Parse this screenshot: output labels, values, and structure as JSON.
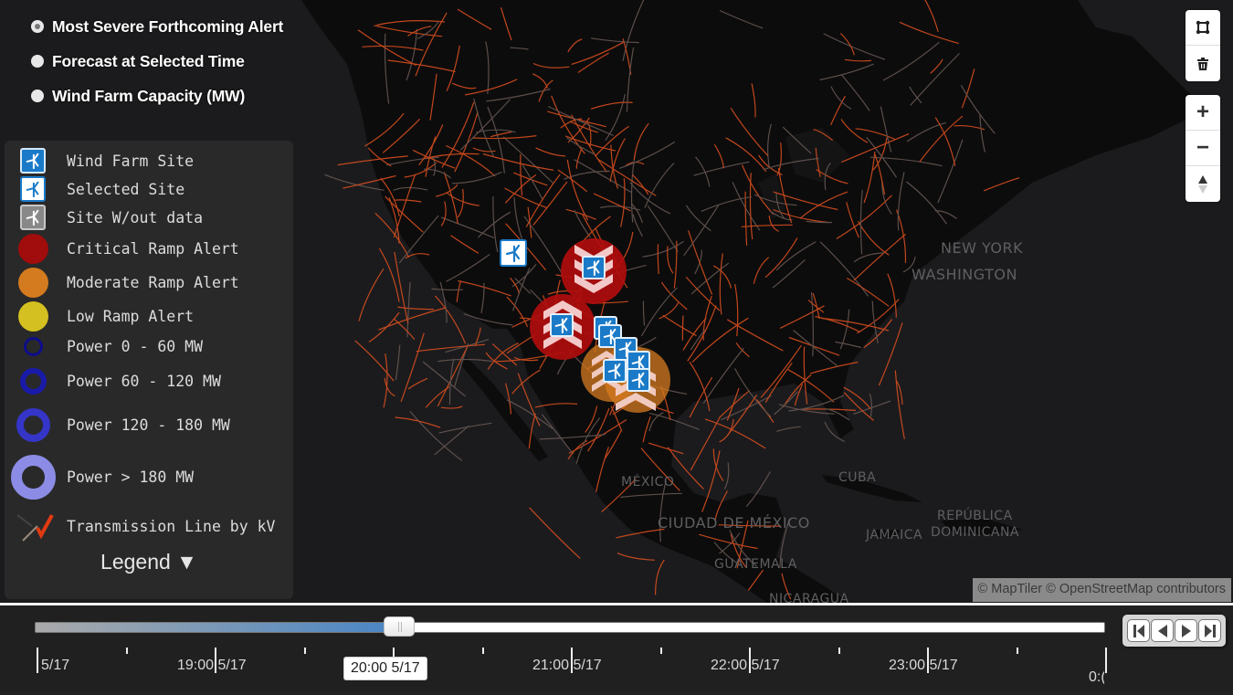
{
  "layer_selector": {
    "options": [
      {
        "label": "Most Severe Forthcoming Alert",
        "checked": true
      },
      {
        "label": "Forecast at Selected Time",
        "checked": false
      },
      {
        "label": "Wind Farm Capacity (MW)",
        "checked": false
      }
    ]
  },
  "legend": {
    "items": [
      {
        "symbol": "wind-farm-site-icon",
        "label": "Wind Farm Site"
      },
      {
        "symbol": "selected-site-icon",
        "label": "Selected Site"
      },
      {
        "symbol": "site-without-data-icon",
        "label": "Site W/out data"
      },
      {
        "symbol": "critical-alert-circle",
        "label": "Critical Ramp Alert",
        "color": "#a10c0c"
      },
      {
        "symbol": "moderate-alert-circle",
        "label": "Moderate Ramp Alert",
        "color": "#d47a1f"
      },
      {
        "symbol": "low-alert-circle",
        "label": "Low Ramp Alert",
        "color": "#d4c020"
      },
      {
        "symbol": "power-ring-0-60",
        "label": "Power 0 - 60 MW",
        "color": "#0d0d8a"
      },
      {
        "symbol": "power-ring-60-120",
        "label": "Power 60 - 120 MW",
        "color": "#1a1aa8"
      },
      {
        "symbol": "power-ring-120-180",
        "label": "Power 120 - 180 MW",
        "color": "#3535c8"
      },
      {
        "symbol": "power-ring-over-180",
        "label": "Power > 180 MW",
        "color": "#8c8ce6"
      },
      {
        "symbol": "transmission-line-icon",
        "label": "Transmission Line by kV",
        "color": "#e03a12"
      }
    ],
    "toggle_label": "Legend ▼"
  },
  "map": {
    "place_labels": [
      "NEW YORK",
      "WASHINGTON",
      "MÉXICO",
      "CIUDAD DE MÉXICO",
      "CUBA",
      "JAMAICA",
      "REPÚBLICA",
      "DOMINICANA",
      "GUATEMALA",
      "NICARAGUA"
    ],
    "attribution": "© MapTiler © OpenStreetMap contributors",
    "colors": {
      "land": "#0c0c0c",
      "water": "#1b1b1d",
      "transmission": "#e2511f"
    },
    "alerts": [
      {
        "severity": "critical",
        "direction": "down",
        "color": "#b00d0d"
      },
      {
        "severity": "critical",
        "direction": "up",
        "color": "#b00d0d"
      },
      {
        "severity": "moderate",
        "direction": "up",
        "color": "#d47a1f"
      }
    ],
    "sites": [
      {
        "state": "selected"
      },
      {
        "state": "site"
      },
      {
        "state": "site"
      },
      {
        "state": "site"
      },
      {
        "state": "site"
      },
      {
        "state": "site"
      },
      {
        "state": "site"
      },
      {
        "state": "site"
      },
      {
        "state": "site"
      }
    ]
  },
  "controls": {
    "draw_polygon": "draw-polygon-icon",
    "delete": "trash-icon",
    "zoom_in": "+",
    "zoom_out": "−",
    "compass": "compass-icon"
  },
  "timeline": {
    "progress": 0.33,
    "current_label": "20:00 5/17",
    "tick_labels": [
      "5/17",
      "19:00 5/17",
      "21:00 5/17",
      "22:00 5/17",
      "23:00 5/17",
      "0:("
    ],
    "play_buttons": [
      "skip-to-start",
      "step-back",
      "play",
      "skip-to-end"
    ]
  }
}
